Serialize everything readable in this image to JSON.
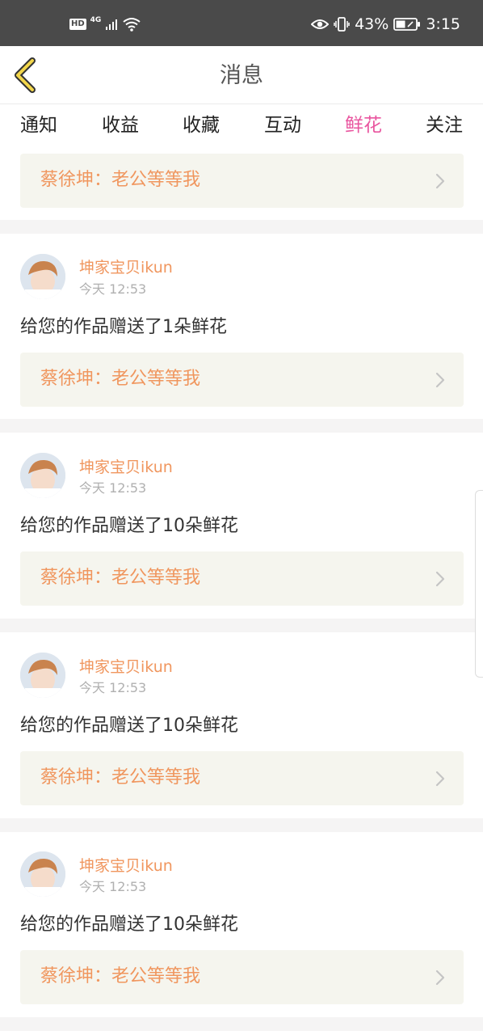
{
  "status_bar": {
    "hd": "HD",
    "network": "4G",
    "battery_percent": "43%",
    "time": "3:15"
  },
  "header": {
    "title": "消息",
    "back_icon": "back-arrow-icon"
  },
  "tabs": [
    {
      "label": "通知",
      "active": false
    },
    {
      "label": "收益",
      "active": false
    },
    {
      "label": "收藏",
      "active": false
    },
    {
      "label": "互动",
      "active": false
    },
    {
      "label": "鲜花",
      "active": true
    },
    {
      "label": "关注",
      "active": false
    }
  ],
  "colors": {
    "accent": "#e9559f",
    "link_text": "#f0965e",
    "card_bg": "#f5f5ee"
  },
  "top_card": {
    "link": "蔡徐坤：老公等等我"
  },
  "messages": [
    {
      "user": "坤家宝贝ikun",
      "time": "今天 12:53",
      "text": "给您的作品赠送了1朵鲜花",
      "link": "蔡徐坤：老公等等我"
    },
    {
      "user": "坤家宝贝ikun",
      "time": "今天 12:53",
      "text": "给您的作品赠送了10朵鲜花",
      "link": "蔡徐坤：老公等等我"
    },
    {
      "user": "坤家宝贝ikun",
      "time": "今天 12:53",
      "text": "给您的作品赠送了10朵鲜花",
      "link": "蔡徐坤：老公等等我"
    },
    {
      "user": "坤家宝贝ikun",
      "time": "今天 12:53",
      "text": "给您的作品赠送了10朵鲜花",
      "link": "蔡徐坤：老公等等我"
    }
  ]
}
